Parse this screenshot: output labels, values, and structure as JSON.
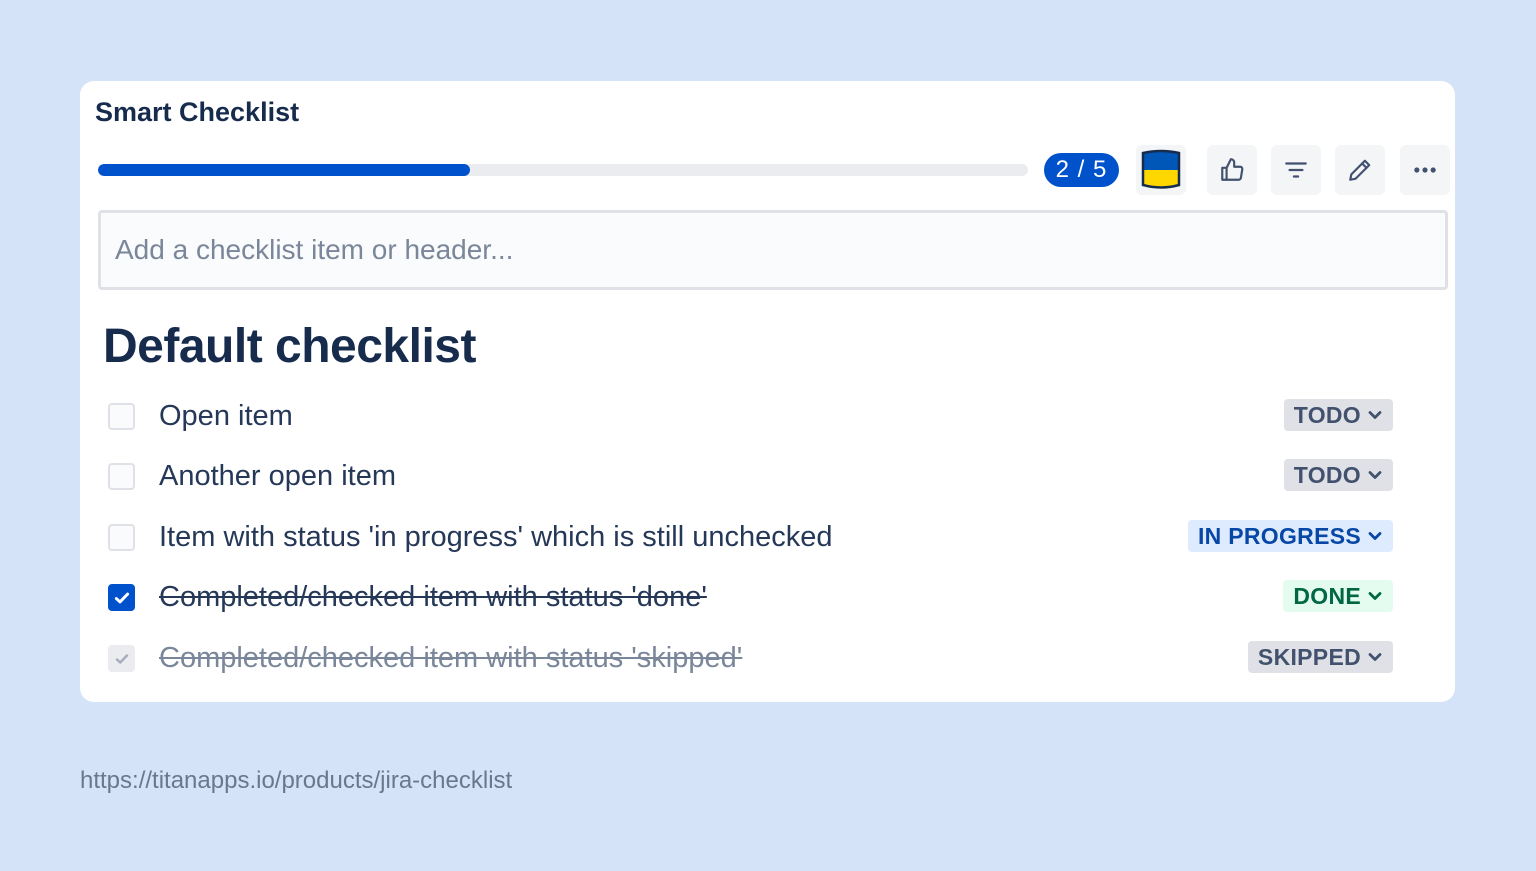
{
  "card": {
    "title": "Smart Checklist"
  },
  "progress": {
    "completed": 2,
    "total": 5,
    "fraction": 0.4,
    "label": "2 / 5",
    "color": "#0052cc"
  },
  "toolbar": {
    "icons": [
      "ukraine-flag-icon",
      "thumbs-up-icon",
      "filter-icon",
      "pencil-icon",
      "more-icon"
    ]
  },
  "add_item": {
    "placeholder": "Add a checklist item or header..."
  },
  "section": {
    "header": "Default checklist"
  },
  "items": [
    {
      "text": "Open item",
      "checked": false,
      "status": "TODO"
    },
    {
      "text": "Another open item",
      "checked": false,
      "status": "TODO"
    },
    {
      "text": "Item with status 'in progress' which is still unchecked",
      "checked": false,
      "status": "IN PROGRESS"
    },
    {
      "text": "Completed/checked item with status 'done'",
      "checked": true,
      "status": "DONE"
    },
    {
      "text": "Completed/checked item with status 'skipped'",
      "checked": true,
      "status": "SKIPPED"
    }
  ],
  "footer": {
    "url": "https://titanapps.io/products/jira-checklist"
  },
  "colors": {
    "background": "#d4e3f8",
    "accent": "#0052cc",
    "flag_blue": "#0057b7",
    "flag_yellow": "#ffd700"
  }
}
